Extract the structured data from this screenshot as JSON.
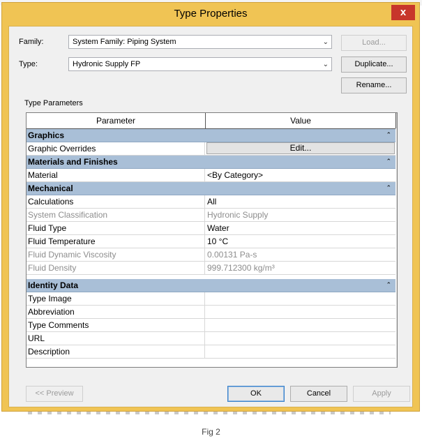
{
  "window": {
    "title": "Type Properties",
    "close_label": "x"
  },
  "form": {
    "family_label": "Family:",
    "family_value": "System Family: Piping System",
    "type_label": "Type:",
    "type_value": "Hydronic Supply FP",
    "type_params_label": "Type Parameters"
  },
  "buttons": {
    "load": "Load...",
    "duplicate": "Duplicate...",
    "rename": "Rename...",
    "preview": "<< Preview",
    "ok": "OK",
    "cancel": "Cancel",
    "apply": "Apply",
    "edit": "Edit..."
  },
  "grid": {
    "headers": [
      "Parameter",
      "Value"
    ],
    "groups": {
      "graphics": "Graphics",
      "materials": "Materials and Finishes",
      "mechanical": "Mechanical",
      "identity": "Identity Data"
    },
    "rows": {
      "graphic_overrides": "Graphic Overrides",
      "material": {
        "param": "Material",
        "value": "<By Category>"
      },
      "calculations": {
        "param": "Calculations",
        "value": "All"
      },
      "system_classification": {
        "param": "System Classification",
        "value": "Hydronic Supply"
      },
      "fluid_type": {
        "param": "Fluid Type",
        "value": "Water"
      },
      "fluid_temperature": {
        "param": "Fluid Temperature",
        "value": "10 °C"
      },
      "fluid_viscosity": {
        "param": "Fluid Dynamic Viscosity",
        "value": "0.00131 Pa-s"
      },
      "fluid_density": {
        "param": "Fluid Density",
        "value": "999.712300 kg/m³"
      },
      "type_image": "Type Image",
      "abbreviation": "Abbreviation",
      "type_comments": "Type Comments",
      "url": "URL",
      "description": "Description"
    }
  },
  "caption": "Fig 2",
  "icons": {
    "collapse": "double-chevron-up-icon",
    "dropdown": "chevron-down-icon"
  }
}
